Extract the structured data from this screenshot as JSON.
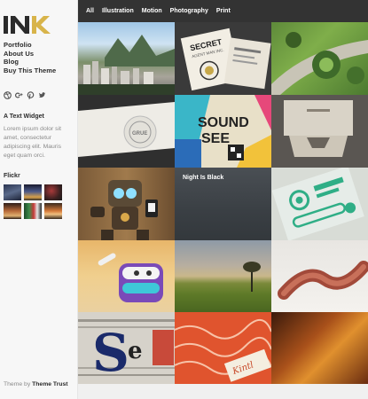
{
  "sidebar": {
    "logo_text": "iNK",
    "nav": [
      {
        "label": "Portfolio"
      },
      {
        "label": "About Us"
      },
      {
        "label": "Blog"
      },
      {
        "label": "Buy This Theme"
      }
    ],
    "social_icons": [
      "dribbble-icon",
      "google-plus-icon",
      "pinterest-icon",
      "twitter-icon"
    ],
    "widget_title": "A Text Widget",
    "widget_text": "Lorem ipsum dolor sit amet, consectetur adipiscing elit. Mauris eget quam orci.",
    "flickr_title": "Flickr",
    "footer": {
      "prefix": "Theme by",
      "brand": "Theme Trust"
    }
  },
  "filters": [
    "All",
    "Illustration",
    "Motion",
    "Photography",
    "Print"
  ],
  "tiles": [
    {
      "name": "tile-city-photo",
      "caption": ""
    },
    {
      "name": "tile-business-card",
      "caption": ""
    },
    {
      "name": "tile-aerial-park",
      "caption": ""
    },
    {
      "name": "tile-stamp-card",
      "caption": ""
    },
    {
      "name": "tile-soundseen-poster",
      "caption": ""
    },
    {
      "name": "tile-letterpress-card",
      "caption": ""
    },
    {
      "name": "tile-robot-illustration",
      "caption": ""
    },
    {
      "name": "tile-night-is-black",
      "caption": "Night Is Black"
    },
    {
      "name": "tile-green-print",
      "caption": ""
    },
    {
      "name": "tile-cartoon-3d",
      "caption": ""
    },
    {
      "name": "tile-field-sunset",
      "caption": ""
    },
    {
      "name": "tile-knot-render",
      "caption": ""
    },
    {
      "name": "tile-newspaper-type",
      "caption": ""
    },
    {
      "name": "tile-orange-pattern",
      "caption": ""
    },
    {
      "name": "tile-blur-orange",
      "caption": ""
    }
  ],
  "colors": {
    "topbar": "#333333",
    "sidebar": "#f7f7f7",
    "text": "#2b2b2b",
    "muted": "#8a8a8a"
  }
}
